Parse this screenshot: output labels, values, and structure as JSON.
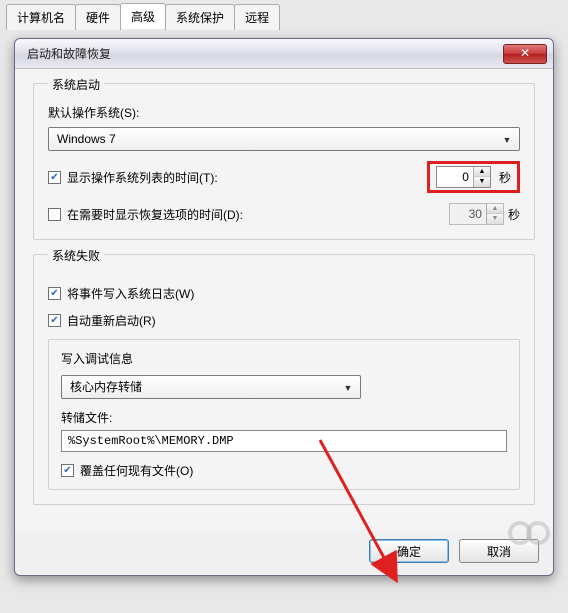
{
  "tabs": {
    "items": [
      "计算机名",
      "硬件",
      "高级",
      "系统保护",
      "远程"
    ],
    "active_index": 2
  },
  "dialog": {
    "title": "启动和故障恢复",
    "close_label": "✕"
  },
  "startup_group": {
    "title": "系统启动",
    "default_os_label": "默认操作系统(S):",
    "default_os_value": "Windows 7",
    "show_list_label": "显示操作系统列表的时间(T):",
    "show_list_checked": true,
    "show_list_value": "0",
    "show_recovery_label": "在需要时显示恢复选项的时间(D):",
    "show_recovery_checked": false,
    "show_recovery_value": "30",
    "seconds_unit": "秒"
  },
  "failure_group": {
    "title": "系统失败",
    "write_log_label": "将事件写入系统日志(W)",
    "write_log_checked": true,
    "auto_restart_label": "自动重新启动(R)",
    "auto_restart_checked": true,
    "debug_group_title": "写入调试信息",
    "debug_select_value": "核心内存转储",
    "dump_file_label": "转储文件:",
    "dump_file_value": "%SystemRoot%\\MEMORY.DMP",
    "overwrite_label": "覆盖任何现有文件(O)",
    "overwrite_checked": true
  },
  "buttons": {
    "ok": "确定",
    "cancel": "取消"
  }
}
